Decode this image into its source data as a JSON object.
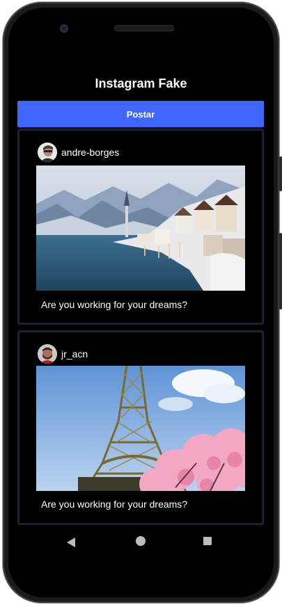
{
  "app": {
    "title": "Instagram Fake"
  },
  "actions": {
    "post_label": "Postar"
  },
  "posts": [
    {
      "username": "andre-borges",
      "caption": "Are you working for your dreams?",
      "image": "winter-lake-village-photo"
    },
    {
      "username": "jr_acn",
      "caption": "Are you working for your dreams?",
      "image": "eiffel-tower-photo"
    }
  ],
  "colors": {
    "accent": "#3f66ff",
    "card_border": "#1c2233",
    "background": "#000000"
  },
  "icons": {
    "nav_back": "back-triangle-icon",
    "nav_home": "home-circle-icon",
    "nav_recent": "recents-square-icon"
  }
}
